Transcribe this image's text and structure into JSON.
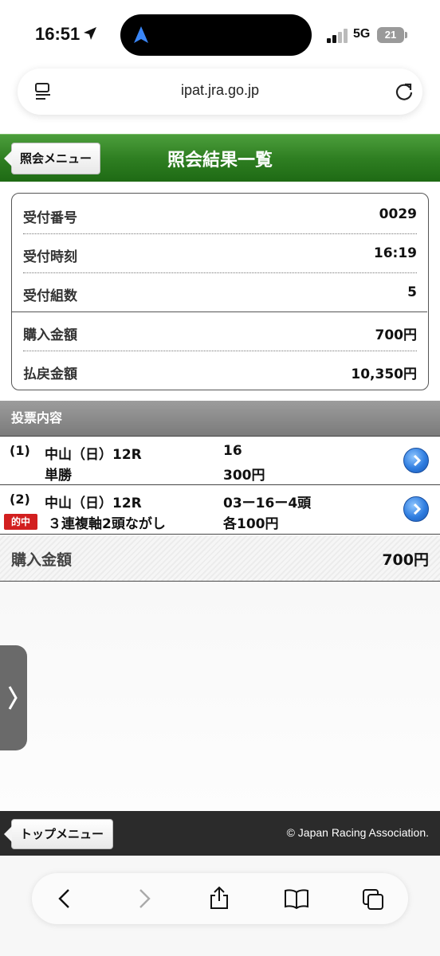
{
  "status_bar": {
    "time": "16:51",
    "network": "5G",
    "battery": "21"
  },
  "browser": {
    "url": "ipat.jra.go.jp"
  },
  "header": {
    "back_label": "照会メニュー",
    "title": "照会結果一覧"
  },
  "summary": [
    {
      "label": "受付番号",
      "value": "0029"
    },
    {
      "label": "受付時刻",
      "value": "16:19"
    },
    {
      "label": "受付組数",
      "value": "5"
    },
    {
      "label": "購入金額",
      "value": "700円"
    },
    {
      "label": "払戻金額",
      "value": "10,350円"
    }
  ],
  "section": {
    "title": "投票内容"
  },
  "bets": [
    {
      "number": "(1)",
      "race": "中山（日）12R",
      "type": "単勝",
      "combination": "16",
      "amount": "300円",
      "badge": ""
    },
    {
      "number": "(2)",
      "race": "中山（日）12R",
      "type": "３連複軸2頭ながし",
      "combination": "03ー16ー4頭",
      "amount": "各100円",
      "badge": "的中"
    }
  ],
  "total": {
    "label": "購入金額",
    "value": "700円"
  },
  "footer": {
    "top_menu_label": "トップメニュー",
    "copyright": "© Japan Racing Association."
  },
  "colors": {
    "header_green": "#2f7f22",
    "hit_red": "#d21f1f",
    "chevron_blue": "#2f7de0"
  }
}
